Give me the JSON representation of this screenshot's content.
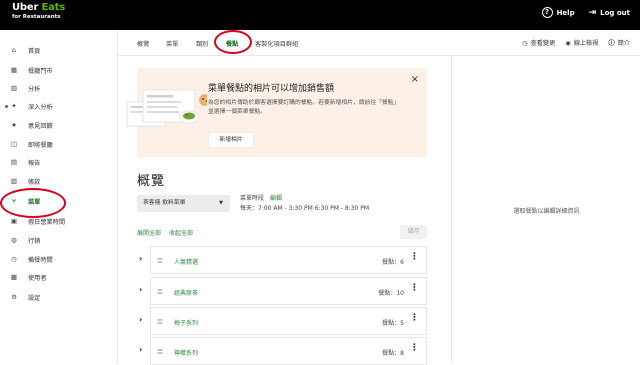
{
  "topbar": {
    "brand_line1_uber": "Uber",
    "brand_line1_eats": "Eats",
    "brand_line2": "for Restaurants",
    "help": "Help",
    "logout": "Log out"
  },
  "sidebar": {
    "items": [
      {
        "icon": "home-icon",
        "glyph": "⌂",
        "label": "首頁"
      },
      {
        "icon": "store-icon",
        "glyph": "▦",
        "label": "餐廳門市"
      },
      {
        "icon": "analytics-icon",
        "glyph": "▥",
        "label": "分析"
      },
      {
        "icon": "insights-icon",
        "glyph": "✦",
        "label": "深入分析"
      },
      {
        "icon": "star-icon",
        "glyph": "★",
        "label": "意見回饋"
      },
      {
        "icon": "bag-icon",
        "glyph": "◫",
        "label": "即將餐廳"
      },
      {
        "icon": "report-icon",
        "glyph": "▤",
        "label": "報告"
      },
      {
        "icon": "invoice-icon",
        "glyph": "▧",
        "label": "帳款"
      },
      {
        "icon": "menu-icon",
        "glyph": "⑂",
        "label": "菜單"
      },
      {
        "icon": "calendar-icon",
        "glyph": "▣",
        "label": "假日營業時間"
      },
      {
        "icon": "marketing-icon",
        "glyph": "◍",
        "label": "行銷"
      },
      {
        "icon": "prep-time-icon",
        "glyph": "◷",
        "label": "備餐時間"
      },
      {
        "icon": "users-icon",
        "glyph": "▩",
        "label": "使用者"
      },
      {
        "icon": "settings-icon",
        "glyph": "⚙",
        "label": "設定"
      }
    ]
  },
  "subnav": {
    "tabs": [
      "概覽",
      "菜單",
      "類別",
      "餐點",
      "客製化項目群組"
    ],
    "active_tab": "餐點",
    "right": [
      {
        "icon": "history-icon",
        "glyph": "◷",
        "label": "查看變更"
      },
      {
        "icon": "eye-icon",
        "glyph": "◉",
        "label": "線上檢視"
      },
      {
        "icon": "info-icon",
        "glyph": "ⓘ",
        "label": "簡介"
      }
    ]
  },
  "banner": {
    "title": "菜單餐點的相片可以增加銷售額",
    "body": "為您的相片傳助於顧客選擇要訂購的餐點。若要新增相片，請前往「餐點」並選擇一個菜單餐點。",
    "button": "新增相片",
    "close": "×"
  },
  "right_panel": {
    "hint": "選取餐點以編輯詳細資訊"
  },
  "overview": {
    "title": "概覽",
    "menu_select": "茶客棧 飲料菜單",
    "hours_label": "菜單時段",
    "hours_edit": "編輯",
    "hours_value": "每天：7:00 AM - 3:30 PM 6:30 PM - 8:30 PM",
    "expand_all": "展開全部",
    "collapse_all": "收起全部",
    "save": "儲存"
  },
  "categories": [
    {
      "name": "人氣精選",
      "count": "餐點：6"
    },
    {
      "name": "經典原茶",
      "count": "餐點：10"
    },
    {
      "name": "梅子系列",
      "count": "餐點：5"
    },
    {
      "name": "檸檬系列",
      "count": "餐點：8"
    }
  ],
  "colors": {
    "accent_green": "#2c8a3c",
    "brand_green": "#5fb709",
    "banner_bg": "#fdf0e6",
    "annotation_red": "#d8001b"
  }
}
